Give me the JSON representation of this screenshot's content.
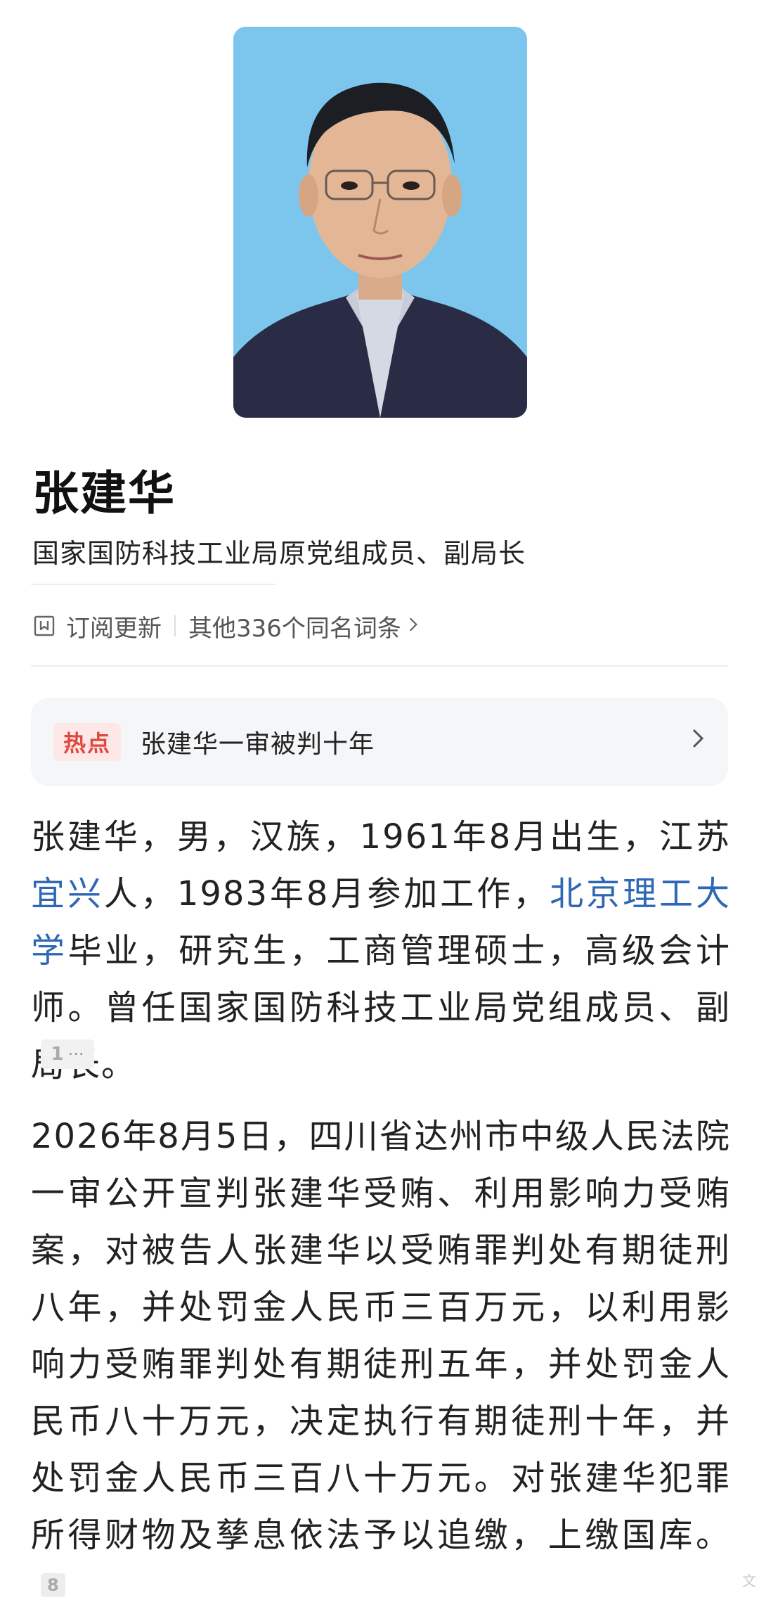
{
  "profile": {
    "name": "张建华",
    "title": "国家国防科技工业局原党组成员、副局长"
  },
  "meta": {
    "subscribe_icon": "bookmark-icon",
    "subscribe_label": "订阅更新",
    "others_label": "其他336个同名词条",
    "chevron_icon": "chevron-right-icon"
  },
  "hot": {
    "badge": "热点",
    "headline": "张建华一审被判十年",
    "chevron_icon": "chevron-right-icon"
  },
  "intro": {
    "t1": "张建华，男，汉族，1961年8月出生，江苏",
    "link1": "宜兴",
    "t2": "人，1983年8月参加工作，",
    "link2": "北京理工大学",
    "t3": "毕业，研究生，工商管理硕士，高级会计师。曾任国家国防科技工业局党组成员、副局长。",
    "ref_number": "1",
    "ref_more": "···"
  },
  "verdict": {
    "text": "2026年8月5日，四川省达州市中级人民法院一审公开宣判张建华受贿、利用影响力受贿案，对被告人张建华以受贿罪判处有期徒刑八年，并处罚金人民币三百万元，以利用影响力受贿罪判处有期徒刑五年，并处罚金人民币八十万元，决定执行有期徒刑十年，并处罚金人民币三百八十万元。对张建华犯罪所得财物及孳息依法予以追缴，上缴国库。",
    "ref_number": "8"
  },
  "watermark": "文",
  "colors": {
    "link": "#2e67b5",
    "hot_badge_text": "#e0483d",
    "hot_badge_bg": "#fde7e7",
    "card_bg": "#f5f6f8",
    "portrait_bg": "#7cc6ee"
  }
}
